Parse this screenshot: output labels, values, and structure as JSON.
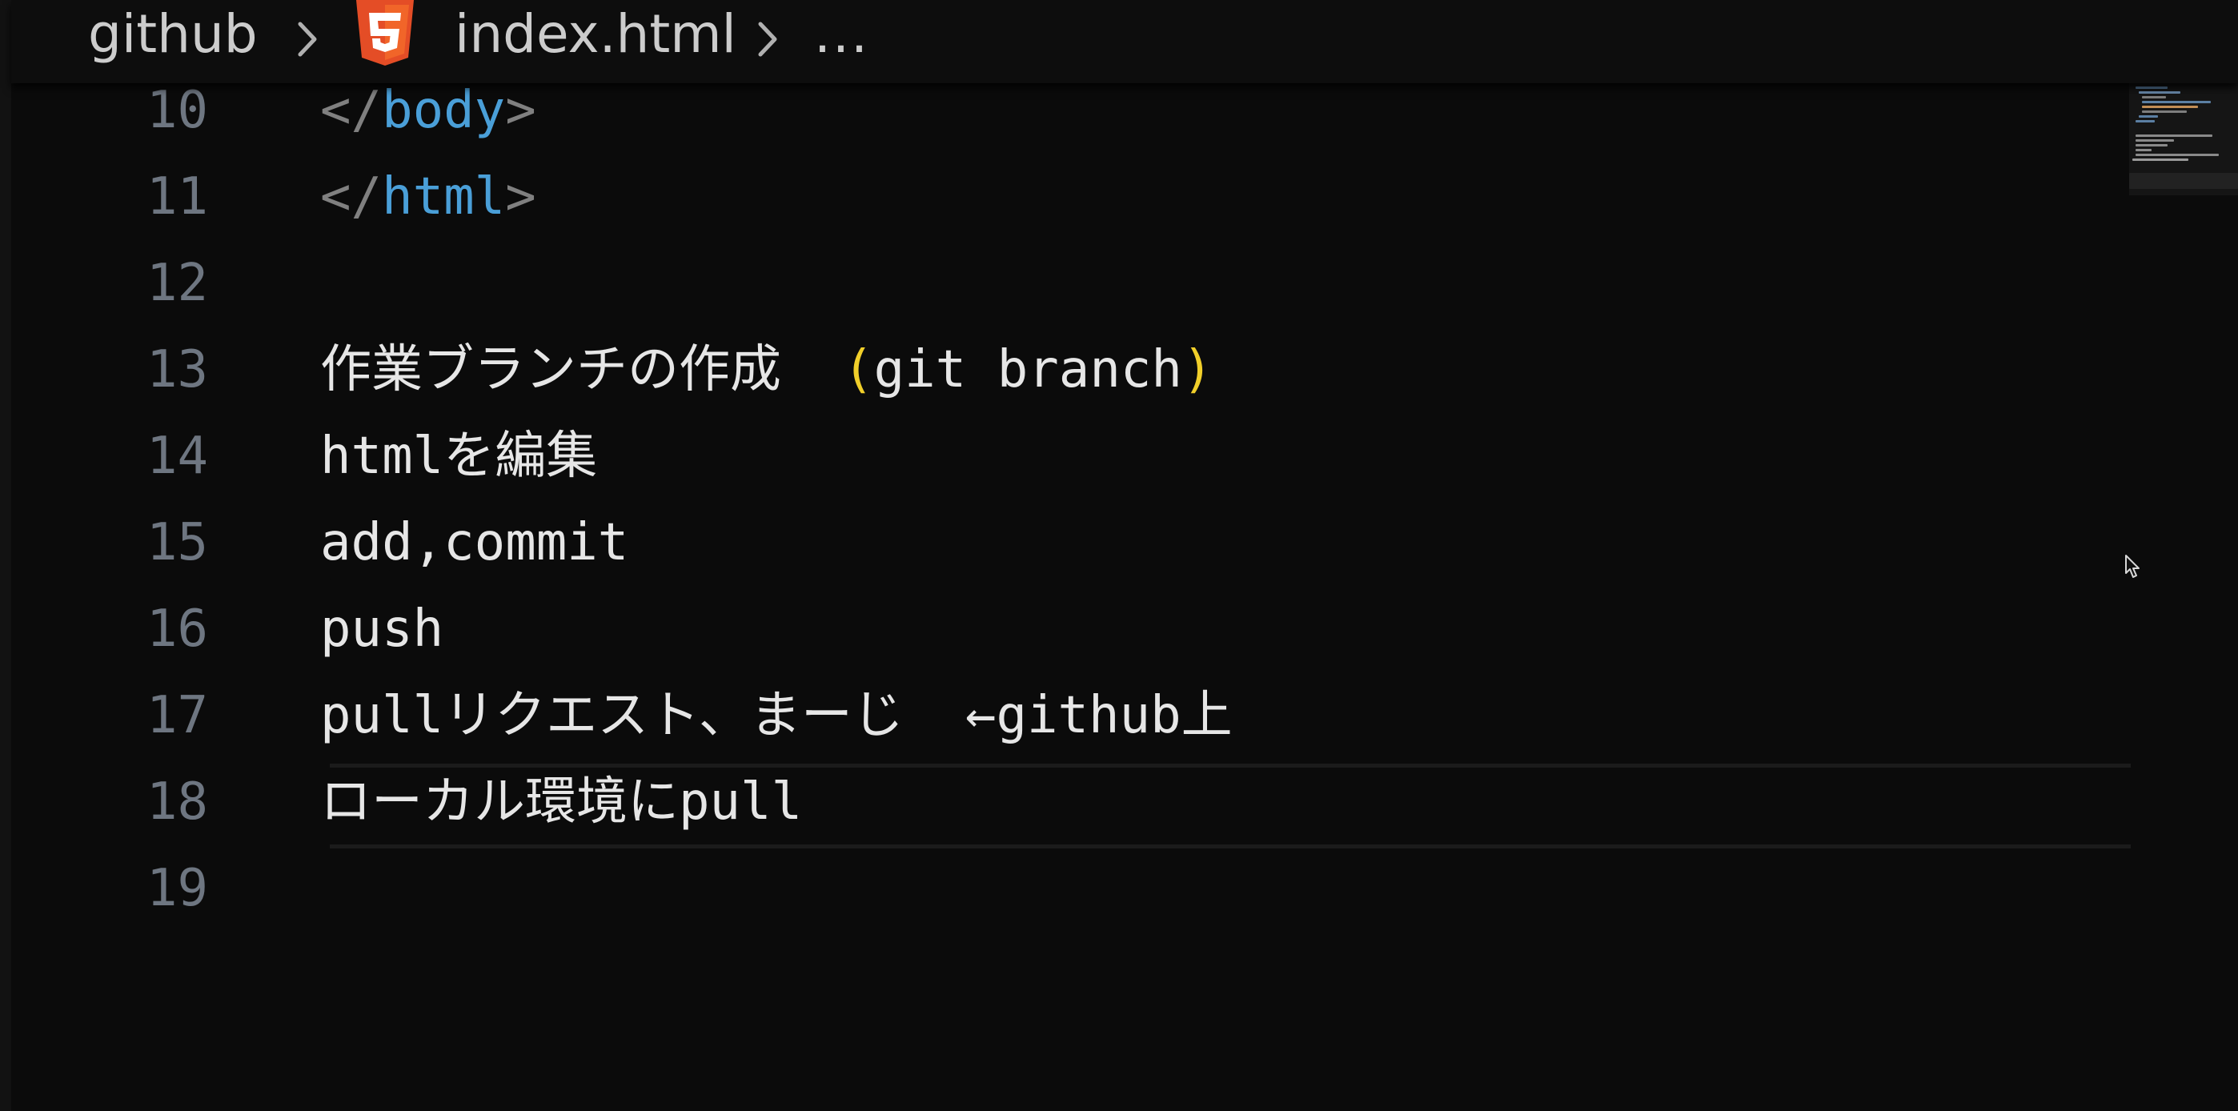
{
  "breadcrumb": {
    "root": "github",
    "file": "index.html",
    "ellipsis": "..."
  },
  "editor": {
    "current_line": "18",
    "lines": [
      {
        "number": "10",
        "punct_open": "</",
        "tag": "body",
        "punct_close": ">"
      },
      {
        "number": "11",
        "punct_open": "</",
        "tag": "html",
        "punct_close": ">"
      },
      {
        "number": "12",
        "text": ""
      },
      {
        "number": "13",
        "text": "作業ブランチの作成  ",
        "paren_open": "(",
        "inner": "git branch",
        "paren_close": ")"
      },
      {
        "number": "14",
        "text": "htmlを編集"
      },
      {
        "number": "15",
        "text": "add,commit"
      },
      {
        "number": "16",
        "text": "push"
      },
      {
        "number": "17",
        "text": "pullリクエスト、まーじ  ←github上"
      },
      {
        "number": "18",
        "text": "ローカル環境にpull"
      },
      {
        "number": "19",
        "text": ""
      }
    ]
  },
  "icons": {
    "file_icon": "html5-icon",
    "chevrons": "chevron-right-icon",
    "cursor": "mouse-pointer-icon"
  },
  "colors": {
    "background": "#0b0b0b",
    "line_number": "#6e7681",
    "tag_name": "#4a9fd8",
    "tag_punct": "#808080",
    "bracket": "#f1cf2a",
    "text": "#e6e6e6",
    "html5_orange": "#e44d26"
  }
}
